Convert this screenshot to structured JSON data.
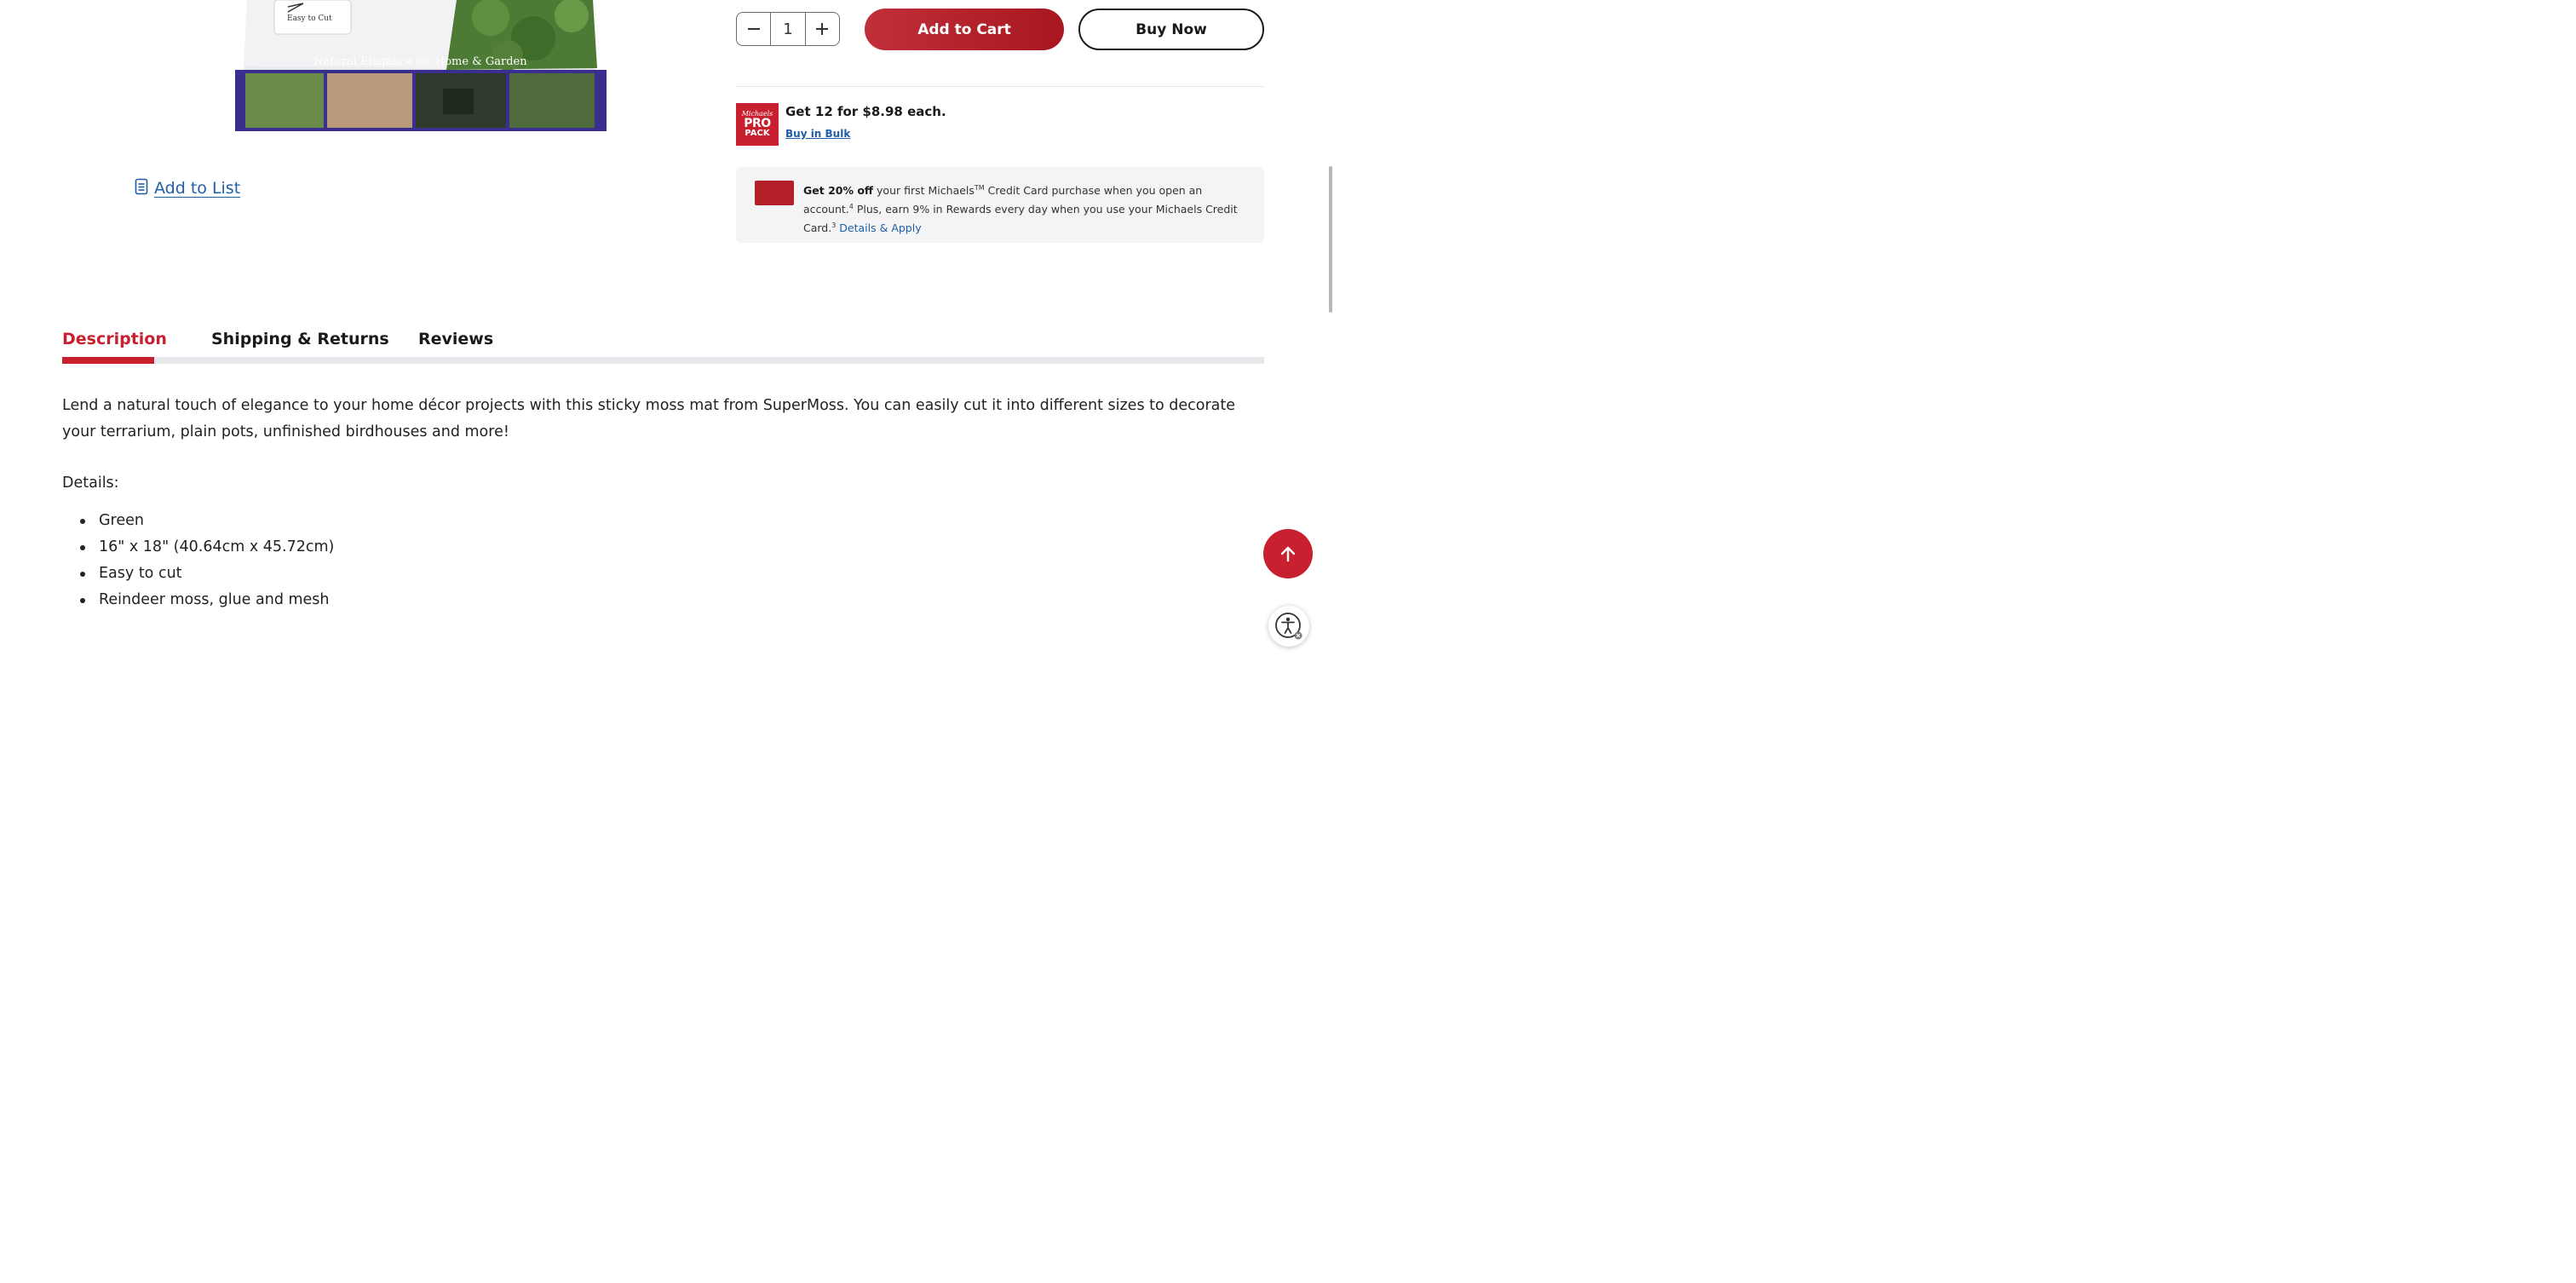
{
  "product": {
    "image_easy_cut": "Easy to Cut",
    "image_tagline": "Natural Elegance for Home & Garden",
    "add_to_list": "Add to List"
  },
  "purchase": {
    "quantity": "1",
    "add_to_cart": "Add to Cart",
    "buy_now": "Buy Now"
  },
  "pro_pack": {
    "logo_line1": "Michaels",
    "logo_line2": "PRO",
    "logo_line3": "PACK",
    "bulk_text": "Get 12 for $8.98 each.",
    "bulk_link": "Buy in Bulk"
  },
  "promo": {
    "bold": "Get 20% off",
    "t1": " your first Michaels",
    "tm": "TM",
    "t2": " Credit Card purchase when you open an account.",
    "sup4": "4",
    "t3": " Plus, earn 9% in Rewards every day when you use your Michaels Credit Card.",
    "sup3": "3",
    "link": " Details & Apply"
  },
  "tabs": {
    "description": "Description",
    "shipping": "Shipping & Returns",
    "reviews": "Reviews"
  },
  "description": {
    "text": "Lend a natural touch of elegance to your home décor projects with this sticky moss mat from SuperMoss. You can easily cut it into different sizes to decorate your terrarium, plain pots, unfinished birdhouses and more!",
    "details_label": "Details:",
    "details": [
      "Green",
      "16\" x 18\" (40.64cm x 45.72cm)",
      "Easy to cut",
      "Reindeer moss, glue and mesh"
    ]
  },
  "colors": {
    "brand_red": "#c8202e",
    "link_blue": "#1f5fa8"
  },
  "icons": {
    "list": "list-icon",
    "minus": "minus-icon",
    "plus": "plus-icon",
    "arrow_up": "arrow-up-icon",
    "accessibility": "accessibility-icon"
  }
}
